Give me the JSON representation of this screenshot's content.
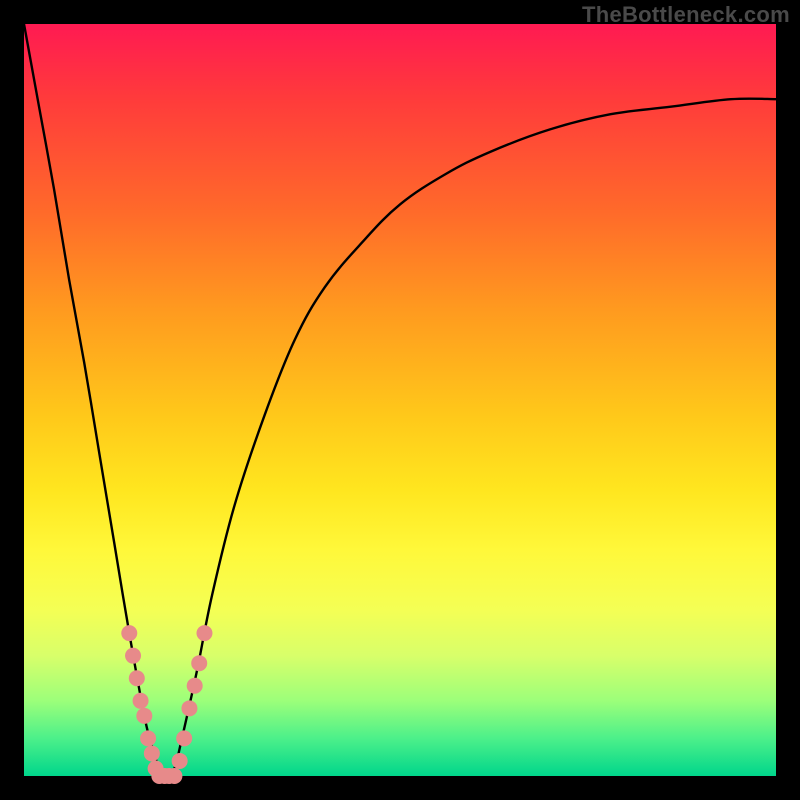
{
  "watermark": "TheBottleneck.com",
  "colors": {
    "curve_stroke": "#000000",
    "marker_fill": "#e78a8a",
    "marker_stroke": "#d46a6a",
    "gradient_top": "#ff1a52",
    "gradient_bottom": "#00d68b"
  },
  "chart_data": {
    "type": "line",
    "title": "",
    "xlabel": "",
    "ylabel": "",
    "xlim": [
      0,
      100
    ],
    "ylim": [
      0,
      100
    ],
    "grid": false,
    "series": [
      {
        "name": "bottleneck-curve",
        "x": [
          0,
          2,
          4,
          6,
          8,
          10,
          12,
          14,
          16,
          17,
          18,
          19,
          20,
          21,
          23,
          25,
          28,
          32,
          36,
          40,
          45,
          50,
          56,
          62,
          70,
          78,
          86,
          94,
          100
        ],
        "y": [
          100,
          89,
          78,
          66,
          55,
          43,
          31,
          19,
          8,
          4,
          1,
          0,
          1,
          5,
          14,
          24,
          36,
          48,
          58,
          65,
          71,
          76,
          80,
          83,
          86,
          88,
          89,
          90,
          90
        ]
      }
    ],
    "markers": [
      {
        "x": 14.0,
        "y": 19
      },
      {
        "x": 14.5,
        "y": 16
      },
      {
        "x": 15.0,
        "y": 13
      },
      {
        "x": 15.5,
        "y": 10
      },
      {
        "x": 16.0,
        "y": 8
      },
      {
        "x": 16.5,
        "y": 5
      },
      {
        "x": 17.0,
        "y": 3
      },
      {
        "x": 17.5,
        "y": 1
      },
      {
        "x": 18.0,
        "y": 0
      },
      {
        "x": 18.7,
        "y": 0
      },
      {
        "x": 19.3,
        "y": 0
      },
      {
        "x": 20.0,
        "y": 0
      },
      {
        "x": 20.7,
        "y": 2
      },
      {
        "x": 21.3,
        "y": 5
      },
      {
        "x": 22.0,
        "y": 9
      },
      {
        "x": 22.7,
        "y": 12
      },
      {
        "x": 23.3,
        "y": 15
      },
      {
        "x": 24.0,
        "y": 19
      }
    ],
    "marker_radius_px": 8
  }
}
